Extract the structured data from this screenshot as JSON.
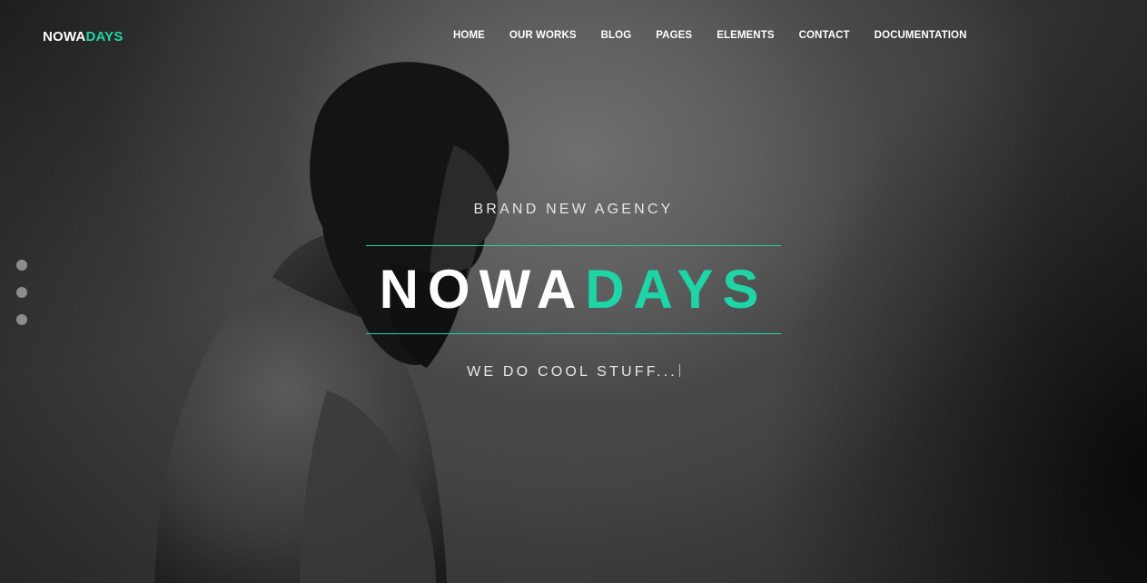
{
  "brand": {
    "part1": "NOWA",
    "part2": "DAYS"
  },
  "nav": {
    "items": [
      {
        "label": "HOME"
      },
      {
        "label": "OUR WORKS"
      },
      {
        "label": "BLOG"
      },
      {
        "label": "PAGES"
      },
      {
        "label": "ELEMENTS"
      },
      {
        "label": "CONTACT"
      },
      {
        "label": "DOCUMENTATION"
      }
    ]
  },
  "hero": {
    "kicker": "BRAND NEW AGENCY",
    "title_part1": "NOWA",
    "title_part2": "DAYS",
    "subtitle": "WE DO COOL STUFF..."
  },
  "slider": {
    "dot_count": 3
  },
  "colors": {
    "accent": "#1fd5a6",
    "text": "#ffffff",
    "background": "#3a3a3a"
  }
}
